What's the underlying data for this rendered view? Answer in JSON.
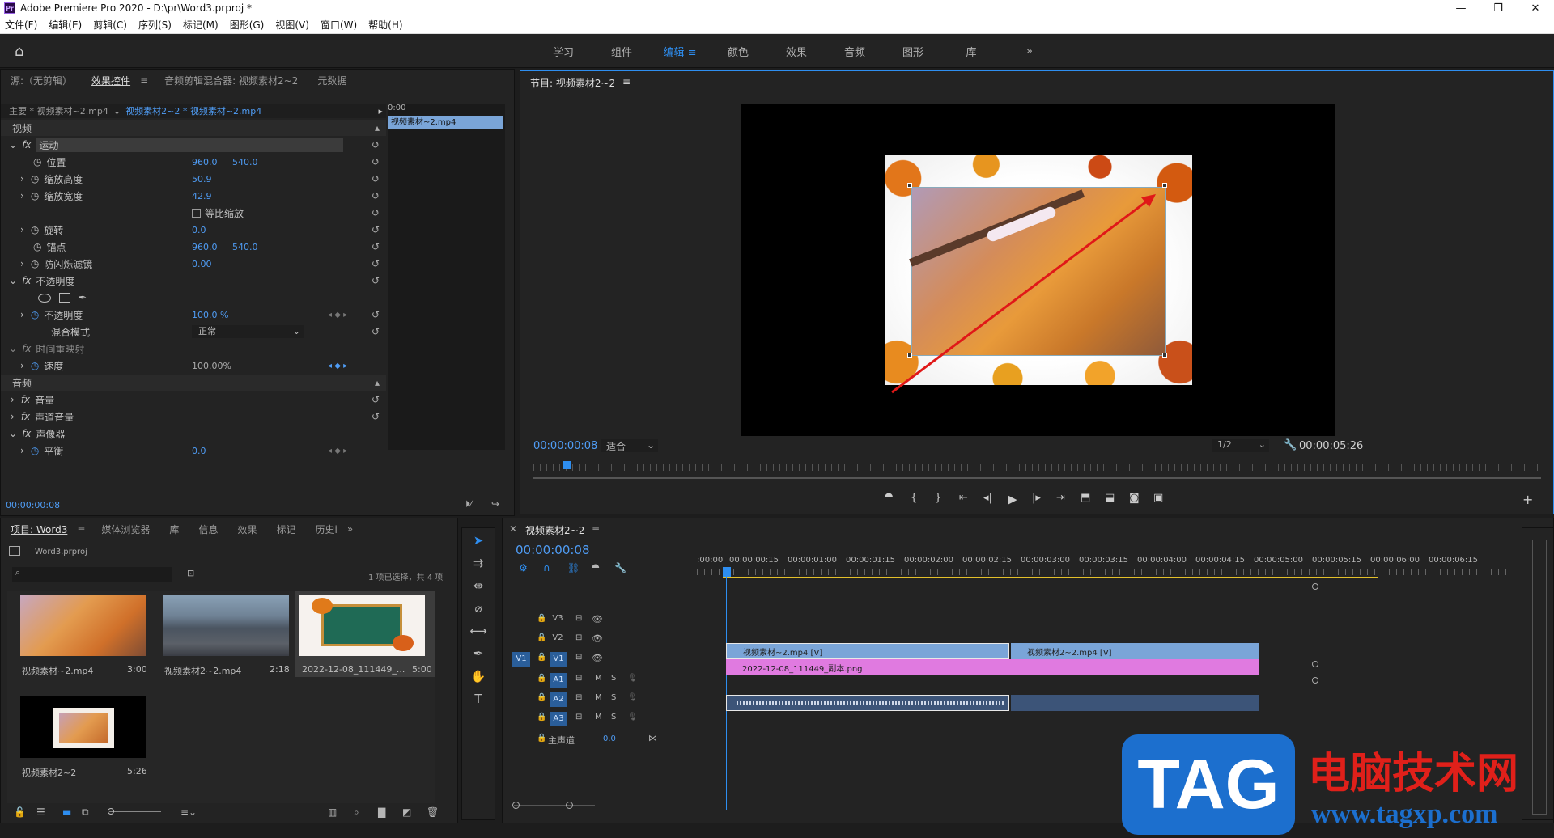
{
  "window": {
    "title": "Adobe Premiere Pro 2020 - D:\\pr\\Word3.prproj *",
    "logo": "Pr",
    "controls": [
      "—",
      "❐",
      "✕"
    ]
  },
  "menu": [
    "文件(F)",
    "编辑(E)",
    "剪辑(C)",
    "序列(S)",
    "标记(M)",
    "图形(G)",
    "视图(V)",
    "窗口(W)",
    "帮助(H)"
  ],
  "workspaces": {
    "tabs": [
      "学习",
      "组件",
      "编辑",
      "颜色",
      "效果",
      "音频",
      "图形",
      "库"
    ],
    "active": "编辑",
    "more": "»"
  },
  "source_panel": {
    "tabs": [
      "源:（无剪辑）",
      "效果控件",
      "音频剪辑混合器: 视频素材2~2",
      "元数据"
    ],
    "menu_icon": "≡",
    "header_master": "主要 * 视频素材~2.mp4",
    "header_clip": "视频素材2~2 * 视频素材~2.mp4",
    "mini_time": "0:00",
    "mini_clip": "视频素材~2.mp4",
    "section_video": "视频",
    "motion": "运动",
    "position_label": "位置",
    "position_x": "960.0",
    "position_y": "540.0",
    "scale_h_label": "缩放高度",
    "scale_h": "50.9",
    "scale_w_label": "缩放宽度",
    "scale_w": "42.9",
    "uniform_label": "等比缩放",
    "rotation_label": "旋转",
    "rotation": "0.0",
    "anchor_label": "锚点",
    "anchor_x": "960.0",
    "anchor_y": "540.0",
    "flicker_label": "防闪烁滤镜",
    "flicker": "0.00",
    "opacity_section": "不透明度",
    "opacity_label": "不透明度",
    "opacity": "100.0 %",
    "blend_label": "混合模式",
    "blend": "正常",
    "time_remap": "时间重映射",
    "speed_label": "速度",
    "speed": "100.00%",
    "section_audio": "音频",
    "volume": "音量",
    "channel_volume": "声道音量",
    "panner": "声像器",
    "balance_label": "平衡",
    "balance": "0.0",
    "timecode": "00:00:00:08"
  },
  "program": {
    "title": "节目: 视频素材2~2",
    "menu_icon": "≡",
    "timecode": "00:00:00:08",
    "fit": "适合",
    "resolution": "1/2",
    "duration": "00:00:05:26"
  },
  "project": {
    "tabs": [
      "项目: Word3",
      "媒体浏览器",
      "库",
      "信息",
      "效果",
      "标记",
      "历史i"
    ],
    "file": "Word3.prproj",
    "selection": "1 项已选择，共 4 项",
    "items": [
      {
        "name": "视频素材~2.mp4",
        "duration": "3:00"
      },
      {
        "name": "视频素材2~2.mp4",
        "duration": "2:18"
      },
      {
        "name": "2022-12-08_111449_...",
        "duration": "5:00"
      },
      {
        "name": "视频素材2~2",
        "duration": "5:26"
      }
    ]
  },
  "timeline": {
    "title": "视频素材2~2",
    "menu_icon": "≡",
    "timecode": "00:00:00:08",
    "ruler": [
      ":00:00",
      "00:00:00:15",
      "00:00:01:00",
      "00:00:01:15",
      "00:00:02:00",
      "00:00:02:15",
      "00:00:03:00",
      "00:00:03:15",
      "00:00:04:00",
      "00:00:04:15",
      "00:00:05:00",
      "00:00:05:15",
      "00:00:06:00",
      "00:00:06:15"
    ],
    "tracks_video": [
      "V3",
      "V2",
      "V1"
    ],
    "tracks_audio": [
      "A1",
      "A2",
      "A3"
    ],
    "src_v": "V1",
    "master": "主声道",
    "master_val": "0.0",
    "clip_v2a": "视频素材~2.mp4 [V]",
    "clip_v2b": "视频素材2~2.mp4 [V]",
    "clip_v1": "2022-12-08_111449_副本.png",
    "m": "M",
    "s": "S"
  },
  "watermark": {
    "logo": "TAG",
    "cn": "电脑技术网",
    "url": "www.tagxp.com"
  },
  "colors": {
    "accent": "#2e8ef0",
    "clip_blue": "#7aa5d8",
    "clip_pink": "#e07ae0",
    "audio": "#3c5478"
  }
}
